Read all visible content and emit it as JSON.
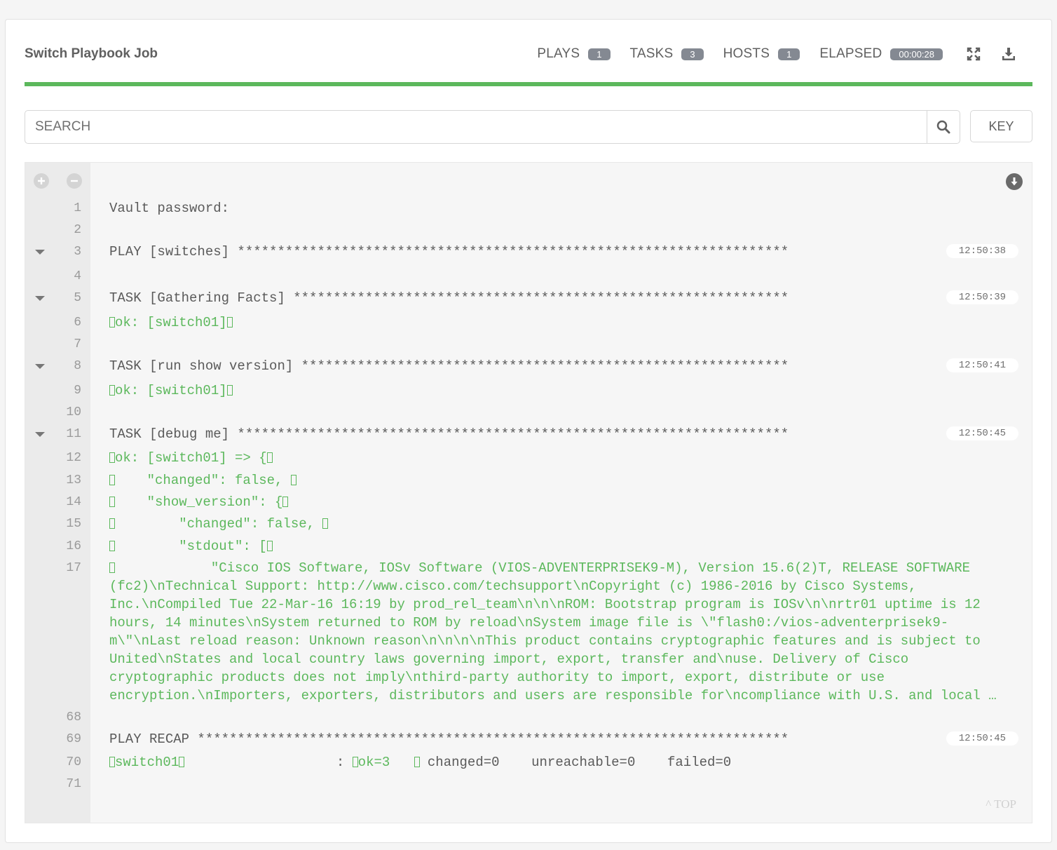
{
  "header": {
    "title": "Switch Playbook Job",
    "stats": [
      {
        "label": "PLAYS",
        "value": "1"
      },
      {
        "label": "TASKS",
        "value": "3"
      },
      {
        "label": "HOSTS",
        "value": "1"
      },
      {
        "label": "ELAPSED",
        "value": "00:00:28"
      }
    ],
    "fullscreen_icon": "expand-icon",
    "download_icon": "download-icon"
  },
  "progress": {
    "percent": 100,
    "color": "#5cb85c"
  },
  "search": {
    "placeholder": "SEARCH",
    "key_label": "KEY"
  },
  "output": {
    "expand_all_icon": "plus-icon",
    "collapse_all_icon": "minus-icon",
    "scroll_icon": "arrow-down-circle-icon",
    "top_link": "^ TOP",
    "lines": [
      {
        "n": "1",
        "text": "Vault password:"
      },
      {
        "n": "2",
        "text": ""
      },
      {
        "n": "3",
        "text": "PLAY [switches] *********************************************************************",
        "time": "12:50:38"
      },
      {
        "n": "4",
        "text": ""
      },
      {
        "n": "5",
        "text": "TASK [Gathering Facts] **************************************************************",
        "time": "12:50:39"
      },
      {
        "n": "6",
        "text": "ok: [switch01]"
      },
      {
        "n": "7",
        "text": ""
      },
      {
        "n": "8",
        "text": "TASK [run show version] *************************************************************",
        "time": "12:50:41"
      },
      {
        "n": "9",
        "text": "ok: [switch01]"
      },
      {
        "n": "10",
        "text": ""
      },
      {
        "n": "11",
        "text": "TASK [debug me] *********************************************************************",
        "time": "12:50:45"
      },
      {
        "n": "12",
        "text": "ok: [switch01] => {"
      },
      {
        "n": "13",
        "text": "    \"changed\": false, "
      },
      {
        "n": "14",
        "text": "    \"show_version\": {"
      },
      {
        "n": "15",
        "text": "        \"changed\": false, "
      },
      {
        "n": "16",
        "text": "        \"stdout\": ["
      },
      {
        "n": "17",
        "text": "            \"Cisco IOS Software, IOSv Software (VIOS-ADVENTERPRISEK9-M), Version 15.6(2)T, RELEASE SOFTWARE (fc2)\\nTechnical Support: http://www.cisco.com/techsupport\\nCopyright (c) 1986-2016 by Cisco Systems, Inc.\\nCompiled Tue 22-Mar-16 16:19 by prod_rel_team\\n\\n\\nROM: Bootstrap program is IOSv\\n\\nrtr01 uptime is 12 hours, 14 minutes\\nSystem returned to ROM by reload\\nSystem image file is \\\"flash0:/vios-adventerprisek9-m\\\"\\nLast reload reason: Unknown reason\\n\\n\\n\\nThis product contains cryptographic features and is subject to United\\nStates and local country laws governing import, export, transfer and\\nuse. Delivery of Cisco cryptographic products does not imply\\nthird-party authority to import, export, distribute or use encryption.\\nImporters, exporters, distributors and users are responsible for\\ncompliance with U.S. and local …"
      },
      {
        "n": "68",
        "text": ""
      },
      {
        "n": "69",
        "text": "PLAY RECAP **************************************************************************",
        "time": "12:50:45"
      },
      {
        "n": "70",
        "host": "switch01",
        "sep": "                   : ",
        "ok": "ok=3",
        "rest": " changed=0    unreachable=0    failed=0"
      },
      {
        "n": "71",
        "text": ""
      }
    ]
  }
}
